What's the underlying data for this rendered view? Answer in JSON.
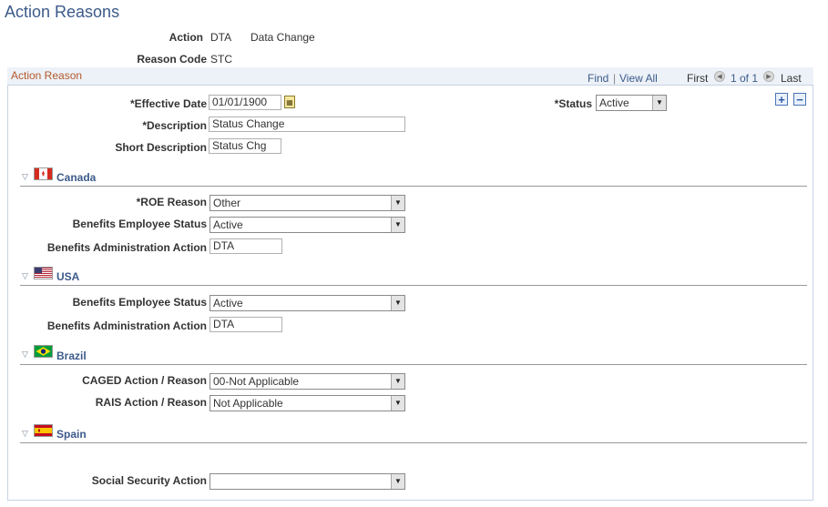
{
  "page": {
    "title": "Action Reasons"
  },
  "summary": {
    "action_label": "Action",
    "action_code": "DTA",
    "action_desc": "Data Change",
    "reason_code_label": "Reason Code",
    "reason_code": "STC"
  },
  "panel": {
    "title": "Action Reason",
    "find": "Find",
    "separator": "|",
    "view_all": "View All",
    "first": "First",
    "range": "1 of 1",
    "last": "Last",
    "prev_icon": "triangle-left",
    "next_icon": "triangle-right"
  },
  "fields": {
    "effective_date_label": "*Effective Date",
    "effective_date": "01/01/1900",
    "status_label": "*Status",
    "status": "Active",
    "description_label": "*Description",
    "description": "Status Change",
    "short_description_label": "Short Description",
    "short_description": "Status Chg"
  },
  "sections": {
    "canada": {
      "name": "Canada",
      "roe_reason_label": "*ROE Reason",
      "roe_reason": "Other",
      "benefits_status_label": "Benefits Employee Status",
      "benefits_status": "Active",
      "benefits_admin_label": "Benefits Administration Action",
      "benefits_admin": "DTA"
    },
    "usa": {
      "name": "USA",
      "benefits_status_label": "Benefits Employee Status",
      "benefits_status": "Active",
      "benefits_admin_label": "Benefits Administration Action",
      "benefits_admin": "DTA"
    },
    "brazil": {
      "name": "Brazil",
      "caged_label": "CAGED Action / Reason",
      "caged": "00-Not Applicable",
      "rais_label": "RAIS Action / Reason",
      "rais": "Not Applicable"
    },
    "spain": {
      "name": "Spain",
      "social_security_label": "Social Security Action",
      "social_security": ""
    }
  },
  "colors": {
    "title_blue": "#3c5a8a",
    "panel_title_orange": "#b5572b",
    "panel_border": "#c6d4e4",
    "panel_header_bg": "#edf2f8"
  }
}
